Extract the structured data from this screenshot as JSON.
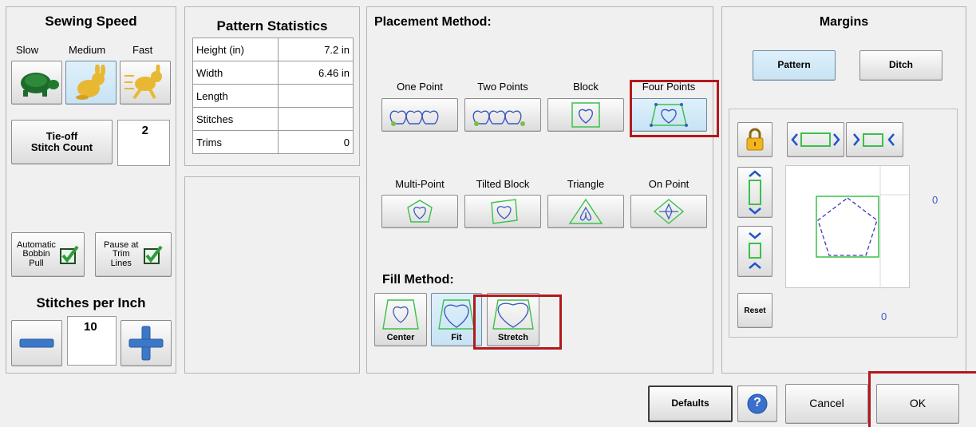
{
  "sewing_speed": {
    "title": "Sewing Speed",
    "options": [
      "Slow",
      "Medium",
      "Fast"
    ],
    "tieoff_label": "Tie-off\nStitch Count",
    "tieoff_value": "2",
    "auto_bobbin_label": "Automatic\nBobbin\nPull",
    "pause_trim_label": "Pause at\nTrim\nLines",
    "spi_title": "Stitches per Inch",
    "spi_value": "10"
  },
  "pattern_stats": {
    "title": "Pattern Statistics",
    "rows": [
      {
        "label": "Height (in)",
        "value": "7.2 in"
      },
      {
        "label": "Width",
        "value": "6.46 in"
      },
      {
        "label": "Length",
        "value": ""
      },
      {
        "label": "Stitches",
        "value": ""
      },
      {
        "label": "Trims",
        "value": "0"
      }
    ]
  },
  "placement": {
    "title": "Placement Method:",
    "methods_row1": [
      "One Point",
      "Two Points",
      "Block",
      "Four Points"
    ],
    "methods_row2": [
      "Multi-Point",
      "Tilted Block",
      "Triangle",
      "On Point"
    ],
    "fill_title": "Fill Method:",
    "fill_options": [
      "Center",
      "Fit",
      "Stretch"
    ]
  },
  "margins": {
    "title": "Margins",
    "pattern_label": "Pattern",
    "ditch_label": "Ditch",
    "reset_label": "Reset",
    "right_value": "0",
    "bottom_value": "0"
  },
  "footer": {
    "defaults_label": "Defaults",
    "help_label": "?",
    "cancel_label": "Cancel",
    "ok_label": "OK"
  },
  "colors": {
    "highlight_red": "#b3191c",
    "accent_green": "#3ac14a",
    "shape_blue": "#3b5bbd"
  }
}
